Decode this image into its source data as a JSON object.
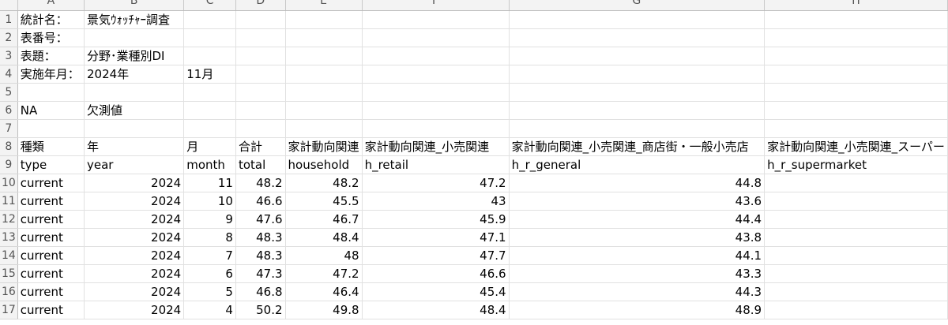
{
  "columns": [
    "A",
    "B",
    "C",
    "D",
    "E",
    "F",
    "G",
    "H"
  ],
  "rows": [
    {
      "num": "1",
      "cells": [
        "統計名：",
        "景気ｳｫｯﾁｬｰ調査",
        "",
        "",
        "",
        "",
        "",
        ""
      ]
    },
    {
      "num": "2",
      "cells": [
        "表番号：",
        "",
        "",
        "",
        "",
        "",
        "",
        ""
      ]
    },
    {
      "num": "3",
      "cells": [
        "表題：",
        "分野･業種別DI",
        "",
        "",
        "",
        "",
        "",
        ""
      ]
    },
    {
      "num": "4",
      "cells": [
        "実施年月：",
        "2024年",
        "11月",
        "",
        "",
        "",
        "",
        ""
      ]
    },
    {
      "num": "5",
      "cells": [
        "",
        "",
        "",
        "",
        "",
        "",
        "",
        ""
      ]
    },
    {
      "num": "6",
      "cells": [
        "NA",
        "欠測値",
        "",
        "",
        "",
        "",
        "",
        ""
      ]
    },
    {
      "num": "7",
      "cells": [
        "",
        "",
        "",
        "",
        "",
        "",
        "",
        ""
      ]
    },
    {
      "num": "8",
      "cells": [
        "種類",
        "年",
        "月",
        "合計",
        "家計動向関連",
        "家計動向関連_小売関連",
        "家計動向関連_小売関連_商店街・一般小売店",
        "家計動向関連_小売関連_スーパー"
      ]
    },
    {
      "num": "9",
      "cells": [
        "type",
        "year",
        "month",
        "total",
        "household",
        "h_retail",
        "h_r_general",
        "h_r_supermarket"
      ]
    },
    {
      "num": "10",
      "cells": [
        "current",
        "2024",
        "11",
        "48.2",
        "48.2",
        "47.2",
        "44.8",
        ""
      ]
    },
    {
      "num": "11",
      "cells": [
        "current",
        "2024",
        "10",
        "46.6",
        "45.5",
        "43",
        "43.6",
        ""
      ]
    },
    {
      "num": "12",
      "cells": [
        "current",
        "2024",
        "9",
        "47.6",
        "46.7",
        "45.9",
        "44.4",
        ""
      ]
    },
    {
      "num": "13",
      "cells": [
        "current",
        "2024",
        "8",
        "48.3",
        "48.4",
        "47.1",
        "43.8",
        ""
      ]
    },
    {
      "num": "14",
      "cells": [
        "current",
        "2024",
        "7",
        "48.3",
        "48",
        "47.7",
        "44.1",
        ""
      ]
    },
    {
      "num": "15",
      "cells": [
        "current",
        "2024",
        "6",
        "47.3",
        "47.2",
        "46.6",
        "43.3",
        ""
      ]
    },
    {
      "num": "16",
      "cells": [
        "current",
        "2024",
        "5",
        "46.8",
        "46.4",
        "45.4",
        "44.3",
        ""
      ]
    },
    {
      "num": "17",
      "cells": [
        "current",
        "2024",
        "4",
        "50.2",
        "49.8",
        "48.4",
        "48.9",
        ""
      ]
    }
  ]
}
